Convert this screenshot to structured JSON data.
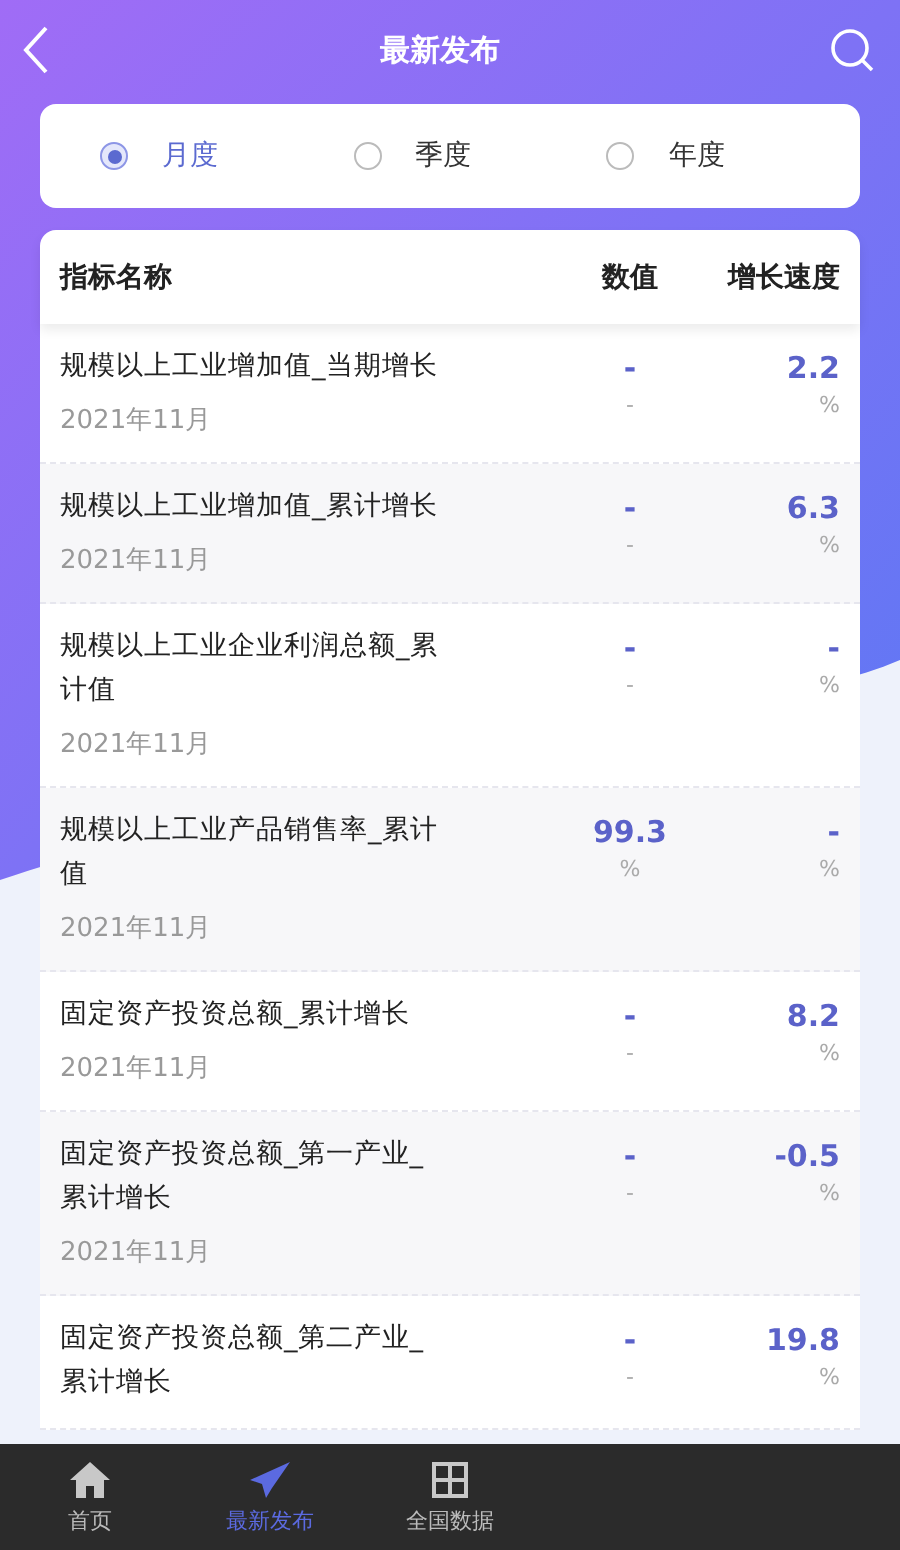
{
  "header": {
    "title": "最新发布"
  },
  "periods": [
    {
      "label": "月度",
      "selected": true
    },
    {
      "label": "季度",
      "selected": false
    },
    {
      "label": "年度",
      "selected": false
    }
  ],
  "table": {
    "columns": [
      "指标名称",
      "数值",
      "增长速度"
    ],
    "rows": [
      {
        "name": "规模以上工业增加值_当期增长",
        "date": "2021年11月",
        "value": "-",
        "value_unit": "-",
        "growth": "2.2",
        "growth_unit": "%"
      },
      {
        "name": "规模以上工业增加值_累计增长",
        "date": "2021年11月",
        "value": "-",
        "value_unit": "-",
        "growth": "6.3",
        "growth_unit": "%"
      },
      {
        "name": "规模以上工业企业利润总额_累计值",
        "date": "2021年11月",
        "value": "-",
        "value_unit": "-",
        "growth": "-",
        "growth_unit": "%"
      },
      {
        "name": "规模以上工业产品销售率_累计值",
        "date": "2021年11月",
        "value": "99.3",
        "value_unit": "%",
        "growth": "-",
        "growth_unit": "%"
      },
      {
        "name": "固定资产投资总额_累计增长",
        "date": "2021年11月",
        "value": "-",
        "value_unit": "-",
        "growth": "8.2",
        "growth_unit": "%"
      },
      {
        "name": "固定资产投资总额_第一产业_累计增长",
        "date": "2021年11月",
        "value": "-",
        "value_unit": "-",
        "growth": "-0.5",
        "growth_unit": "%"
      },
      {
        "name": "固定资产投资总额_第二产业_累计增长",
        "value": "-",
        "value_unit": "-",
        "growth": "19.8",
        "growth_unit": "%"
      }
    ]
  },
  "tab_bar": [
    {
      "label": "首页",
      "selected": false
    },
    {
      "label": "最新发布",
      "selected": true
    },
    {
      "label": "全国数据",
      "selected": false
    }
  ]
}
